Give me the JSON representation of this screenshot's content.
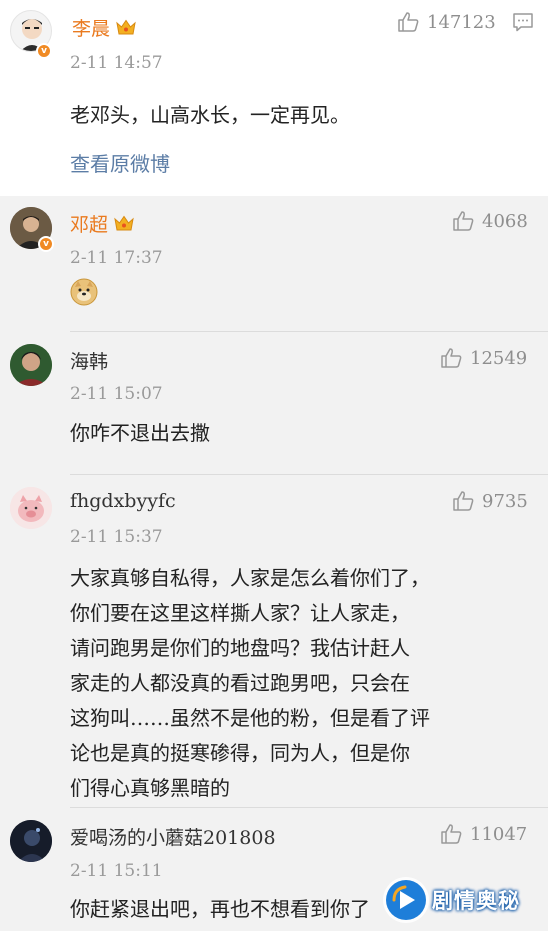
{
  "top_post": {
    "author": "李晨",
    "time": "2-11 14:57",
    "like_count": "147123",
    "content": "老邓头，山高水长，一定再见。",
    "view_original_label": "查看原微博"
  },
  "comments": [
    {
      "author": "邓超",
      "time": "2-11 17:37",
      "like_count": "4068",
      "lines": []
    },
    {
      "author": "海韩",
      "time": "2-11 15:07",
      "like_count": "12549",
      "lines": [
        "你咋不退出去撒"
      ]
    },
    {
      "author": "fhgdxbyyfc",
      "time": "2-11 15:37",
      "like_count": "9735",
      "lines": [
        "大家真够自私得，人家是怎么着你们了，",
        "你们要在这里这样撕人家？让人家走，",
        "请问跑男是你们的地盘吗？我估计赶人",
        "家走的人都没真的看过跑男吧，只会在",
        "这狗叫……虽然不是他的粉，但是看了评",
        "论也是真的挺寒碜得，同为人，但是你",
        "们得心真够黑暗的"
      ]
    },
    {
      "author": "爱喝汤的小蘑菇201808",
      "time": "2-11 15:11",
      "like_count": "11047",
      "lines": [
        "你赶紧退出吧，再也不想看到你了"
      ]
    }
  ],
  "watermark": {
    "text": "剧情奥秘"
  },
  "colors": {
    "vip_name": "#ea7a1f",
    "link": "#5c7da6",
    "verified_badge": "#f08a24"
  },
  "icons": [
    "thumbs-up-icon",
    "comment-icon",
    "crown-icon",
    "verified-badge-icon",
    "doge-emoji-icon"
  ]
}
